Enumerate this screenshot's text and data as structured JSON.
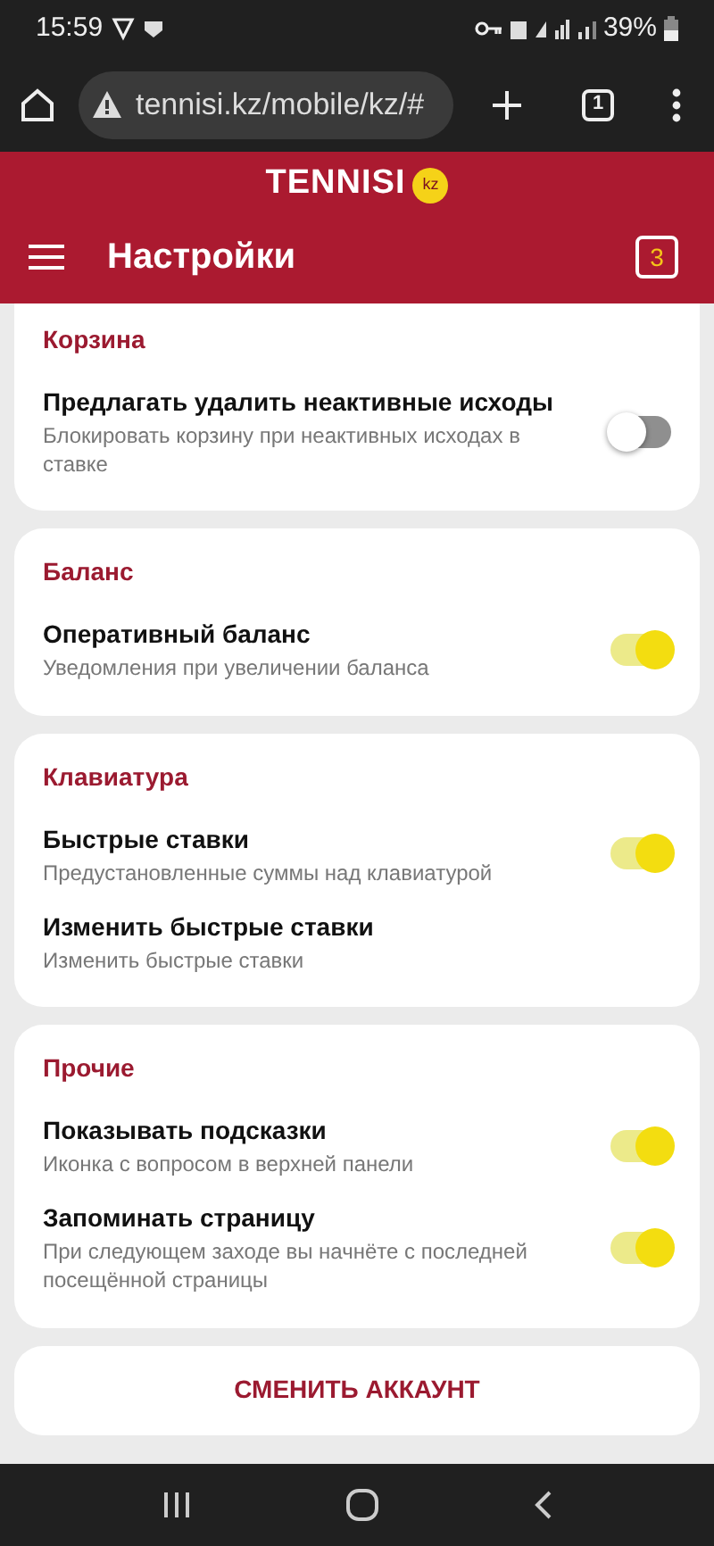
{
  "status_bar": {
    "time": "15:59",
    "battery": "39%"
  },
  "browser": {
    "url": "tennisi.kz/mobile/kz/#",
    "tab_count": "1"
  },
  "header": {
    "logo": "TENNISI",
    "logo_badge": "kz",
    "title": "Настройки",
    "coupon_count": "3"
  },
  "sections": [
    {
      "title": "Корзина",
      "items": [
        {
          "kind": "toggle",
          "label": "Предлагать удалить неактивные исходы",
          "description": "Блокировать корзину при неактивных исходах в ставке",
          "on": false
        }
      ]
    },
    {
      "title": "Баланс",
      "items": [
        {
          "kind": "toggle",
          "label": "Оперативный баланс",
          "description": "Уведомления при увеличении баланса",
          "on": true
        }
      ]
    },
    {
      "title": "Клавиатура",
      "items": [
        {
          "kind": "toggle",
          "label": "Быстрые ставки",
          "description": "Предустановленные суммы над клавиатурой",
          "on": true
        },
        {
          "kind": "link",
          "label": "Изменить быстрые ставки",
          "description": "Изменить быстрые ставки"
        }
      ]
    },
    {
      "title": "Прочие",
      "items": [
        {
          "kind": "toggle",
          "label": "Показывать подсказки",
          "description": "Иконка с вопросом в верхней панели",
          "on": true
        },
        {
          "kind": "toggle",
          "label": "Запоминать страницу",
          "description": "При следующем заходе вы начнёте с последней посещённой страницы",
          "on": true
        }
      ]
    }
  ],
  "switch_account_button": "СМЕНИТЬ АККАУНТ"
}
